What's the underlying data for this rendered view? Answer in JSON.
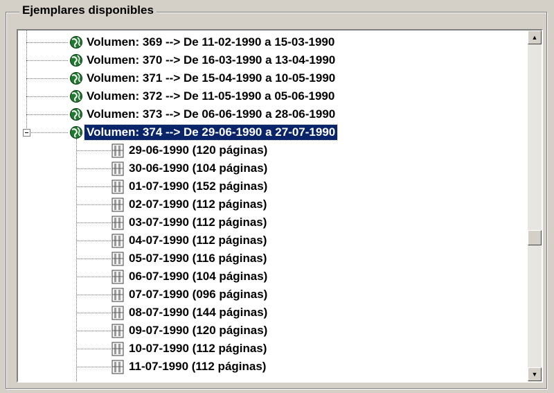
{
  "groupbox": {
    "title": "Ejemplares disponibles"
  },
  "tree": {
    "volumes": [
      {
        "label": "Volumen: 369 --> De 11-02-1990 a 15-03-1990",
        "icon": "globe-icon"
      },
      {
        "label": "Volumen: 370 --> De 16-03-1990 a 13-04-1990",
        "icon": "globe-icon"
      },
      {
        "label": "Volumen: 371 --> De 15-04-1990 a 10-05-1990",
        "icon": "globe-icon"
      },
      {
        "label": "Volumen: 372 --> De 11-05-1990 a 05-06-1990",
        "icon": "globe-icon"
      },
      {
        "label": "Volumen: 373 --> De 06-06-1990 a 28-06-1990",
        "icon": "globe-icon"
      },
      {
        "label": "Volumen: 374 --> De 29-06-1990 a 27-07-1990",
        "icon": "globe-icon",
        "selected": true,
        "expanded": true
      }
    ],
    "issues": [
      {
        "label": "29-06-1990 (120 páginas)",
        "icon": "document-pages-icon"
      },
      {
        "label": "30-06-1990 (104 páginas)",
        "icon": "document-pages-icon"
      },
      {
        "label": "01-07-1990 (152 páginas)",
        "icon": "document-pages-icon"
      },
      {
        "label": "02-07-1990 (112 páginas)",
        "icon": "document-pages-icon"
      },
      {
        "label": "03-07-1990 (112 páginas)",
        "icon": "document-pages-icon"
      },
      {
        "label": "04-07-1990 (112 páginas)",
        "icon": "document-pages-icon"
      },
      {
        "label": "05-07-1990 (116 páginas)",
        "icon": "document-pages-icon"
      },
      {
        "label": "06-07-1990 (104 páginas)",
        "icon": "document-pages-icon"
      },
      {
        "label": "07-07-1990 (096 páginas)",
        "icon": "document-pages-icon"
      },
      {
        "label": "08-07-1990 (144 páginas)",
        "icon": "document-pages-icon"
      },
      {
        "label": "09-07-1990 (120 páginas)",
        "icon": "document-pages-icon"
      },
      {
        "label": "10-07-1990 (112 páginas)",
        "icon": "document-pages-icon"
      },
      {
        "label": "11-07-1990 (112 páginas)",
        "icon": "document-pages-icon"
      }
    ]
  },
  "scrollbar": {
    "up_icon": "scroll-up-arrow-icon",
    "down_icon": "scroll-down-arrow-icon"
  },
  "colors": {
    "selection_bg": "#0a246a",
    "selection_fg": "#ffffff",
    "globe_green": "#1f7a2e"
  }
}
